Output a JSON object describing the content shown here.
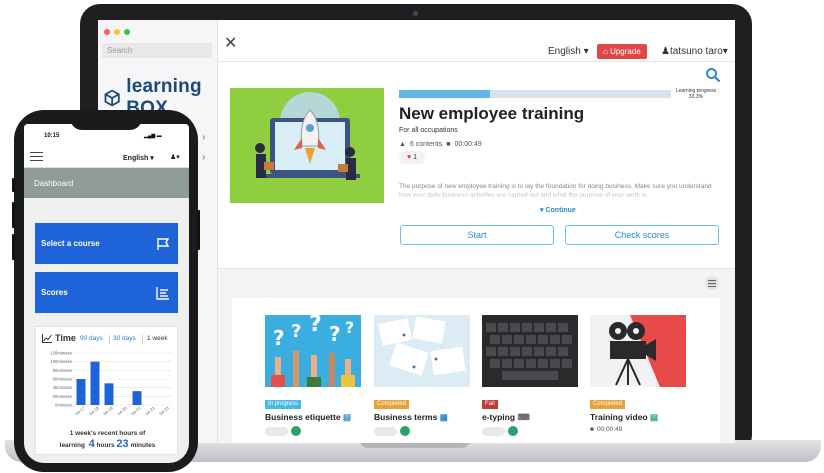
{
  "laptop": {
    "sidebar": {
      "search_placeholder": "Search",
      "logo_text": "learning BOX",
      "window_dots": [
        "#ff6159",
        "#ffbd2e",
        "#27c93f"
      ]
    },
    "topbar": {
      "language": "English",
      "upgrade_label": "Upgrade",
      "user_name": "tatsuno taro"
    },
    "course": {
      "progress_label": "Learning progress",
      "progress_value": "33.3%",
      "progress_fraction": 0.333,
      "title": "New employee training",
      "subtitle": "For all occupations",
      "contents": "6 contents",
      "duration": "00:00:49",
      "likes": "1",
      "description": "The purpose of new employee training is to lay the foundation for doing business. Make sure you understand how your daily business activities are carried out and what the purpose of your work is.",
      "continue_label": "Continue",
      "start_label": "Start",
      "scores_label": "Check scores"
    },
    "cards": [
      {
        "status": "In progress",
        "status_color": "#4ab8e8",
        "name": "Business etiquette",
        "icon": "document-icon"
      },
      {
        "status": "Completed",
        "status_color": "#e8a03a",
        "name": "Business terms",
        "icon": "quiz-icon"
      },
      {
        "status": "Fail",
        "status_color": "#c23a3a",
        "name": "e-typing",
        "icon": "keyboard-icon"
      },
      {
        "status": "Completed",
        "status_color": "#e8a03a",
        "name": "Training video",
        "icon": "document-icon",
        "duration": "00:00:49"
      }
    ]
  },
  "phone": {
    "time": "10:15",
    "language": "English",
    "dashboard_label": "Dashboard",
    "tile_course": "Select a course",
    "tile_scores": "Scores",
    "time_card": {
      "title": "Time",
      "tabs": [
        "90 days",
        "30 days",
        "1 week"
      ],
      "recent_text": "1 week's recent hours of",
      "learning_label": "learning",
      "hours_value": "4",
      "hours_unit": "hours",
      "minutes_value": "23",
      "minutes_unit": "minutes"
    },
    "chart_data": {
      "type": "bar",
      "categories": [
        "04-17",
        "04-18",
        "04-19",
        "04-20",
        "04-21",
        "04-22",
        "04-23"
      ],
      "values": [
        60,
        100,
        50,
        0,
        32,
        0,
        0
      ],
      "y_ticks": [
        "120minutes",
        "100minutes",
        "80minutes",
        "60minutes",
        "40minutes",
        "20minutes",
        "0minutes"
      ],
      "ylim": [
        0,
        120
      ],
      "bar_color": "#1f63d8",
      "grid": true
    }
  }
}
